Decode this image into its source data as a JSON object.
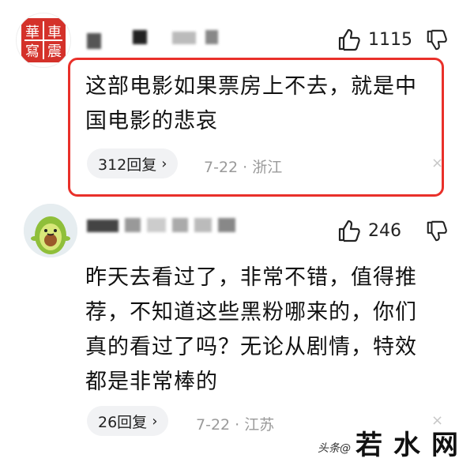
{
  "comments": [
    {
      "likes": "1115",
      "text_lines": [
        "这部电影如果票房上不去，就是中",
        "国电影的悲哀"
      ],
      "reply_label": "312回复",
      "date": "7-22",
      "separator": "·",
      "location": "浙江",
      "close_glyph": "×",
      "seal_chars": [
        "華",
        "車",
        "寫",
        "震"
      ]
    },
    {
      "likes": "246",
      "text_lines": [
        "昨天去看过了，非常不错，值得推",
        "荐，不知道这些黑粉哪来的，你们",
        "真的看过了吗？无论从剧情，特效",
        "都是非常棒的"
      ],
      "reply_label": "26回复",
      "date": "7-22",
      "separator": "·",
      "location": "江苏",
      "close_glyph": "×"
    }
  ],
  "watermark": {
    "small": "头条@",
    "big": "若水网"
  },
  "colors": {
    "highlight_border": "#e9302a",
    "seal_red": "#d4312a",
    "pill_bg": "#f1f2f4",
    "meta_gray": "#9a9a9a"
  },
  "icons": {
    "like": "thumbs-up-icon",
    "dislike": "thumbs-down-icon",
    "chevron": "chevron-right-icon",
    "close": "close-icon"
  }
}
